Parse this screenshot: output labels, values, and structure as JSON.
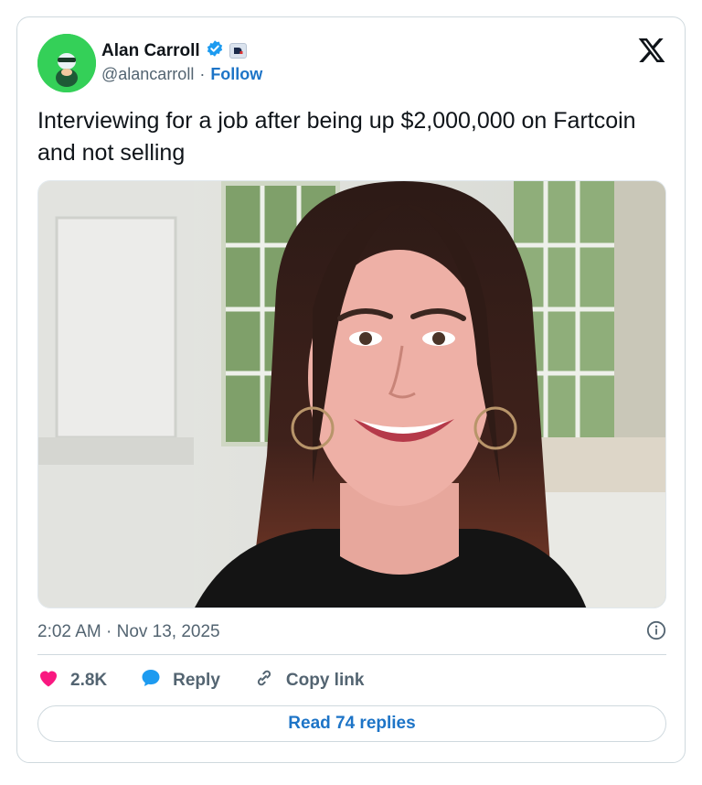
{
  "author": {
    "name": "Alan Carroll",
    "handle": "@alancarroll",
    "separator": "·",
    "follow_label": "Follow"
  },
  "tweet": {
    "text": "Interviewing for a job after being up $2,000,000 on Fartcoin and not selling",
    "timestamp": "2:02 AM · Nov 13, 2025"
  },
  "actions": {
    "likes": "2.8K",
    "reply_label": "Reply",
    "copy_label": "Copy link",
    "read_replies_label": "Read 74 replies"
  },
  "icons": [
    "verified-badge-icon",
    "affiliate-badge-icon",
    "x-logo-icon",
    "info-icon",
    "heart-icon",
    "reply-bubble-icon",
    "link-icon"
  ],
  "colors": {
    "link_blue": "#1d74c7",
    "heart": "#f91880",
    "avatar_bg": "#34d058",
    "verified": "#1d9bf0"
  }
}
